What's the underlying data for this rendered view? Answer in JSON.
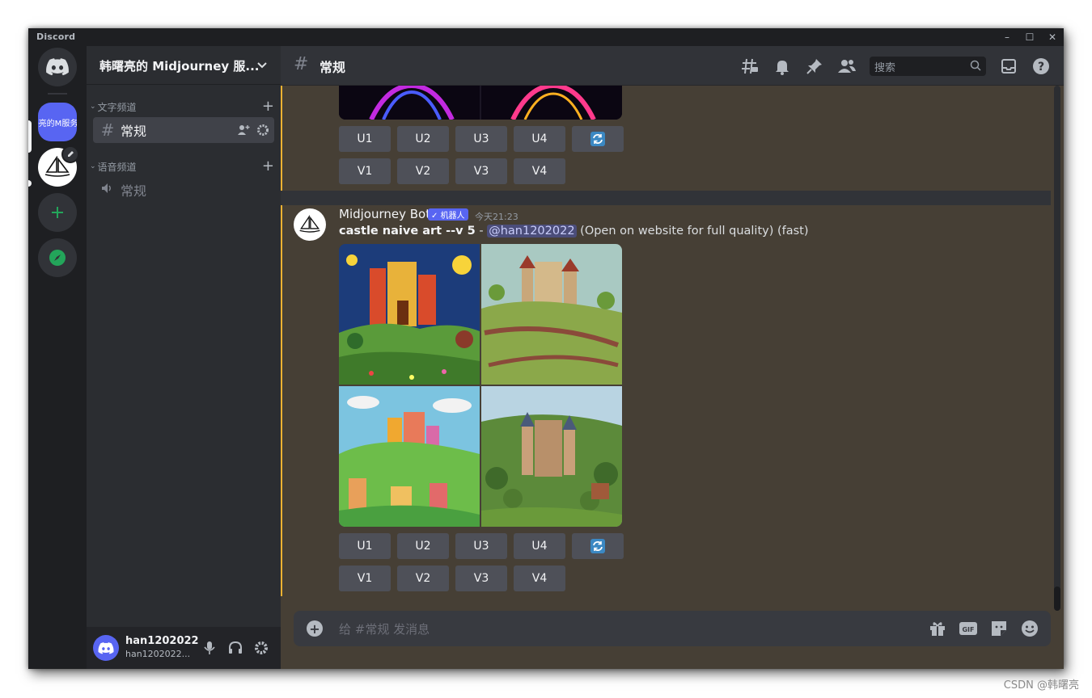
{
  "window": {
    "app_name": "Discord"
  },
  "rail": {
    "guild_label": "曙亮的M服务",
    "items": [
      "home-discord",
      "guild-hanshuliang",
      "midjourney",
      "add-server",
      "explore"
    ]
  },
  "sidebar": {
    "server_name": "韩曙亮的 Midjourney 服...",
    "text_category": "文字频道",
    "text_channel": "常规",
    "voice_category": "语音频道",
    "voice_channel": "常规"
  },
  "user": {
    "name": "han1202022",
    "tag": "han1202022..."
  },
  "header": {
    "channel": "常规",
    "search_placeholder": "搜索"
  },
  "message1": {
    "upscale_buttons": [
      "U1",
      "U2",
      "U3",
      "U4"
    ],
    "variation_buttons": [
      "V1",
      "V2",
      "V3",
      "V4"
    ]
  },
  "message2": {
    "author": "Midjourney Bot",
    "bot_badge": "✓ 机器人",
    "timestamp": "今天21:23",
    "prompt": "castle naive art --v 5",
    "separator": " - ",
    "mention": "@han1202022",
    "suffix": " (Open on website for full quality) (fast)",
    "upscale_buttons": [
      "U1",
      "U2",
      "U3",
      "U4"
    ],
    "variation_buttons": [
      "V1",
      "V2",
      "V3",
      "V4"
    ]
  },
  "composer": {
    "placeholder": "给 #常规 发消息"
  },
  "watermark": "CSDN @韩曙亮",
  "colors": {
    "accent": "#5865f2",
    "highlight_border": "#f0b232",
    "message_bg": "#463f35"
  }
}
